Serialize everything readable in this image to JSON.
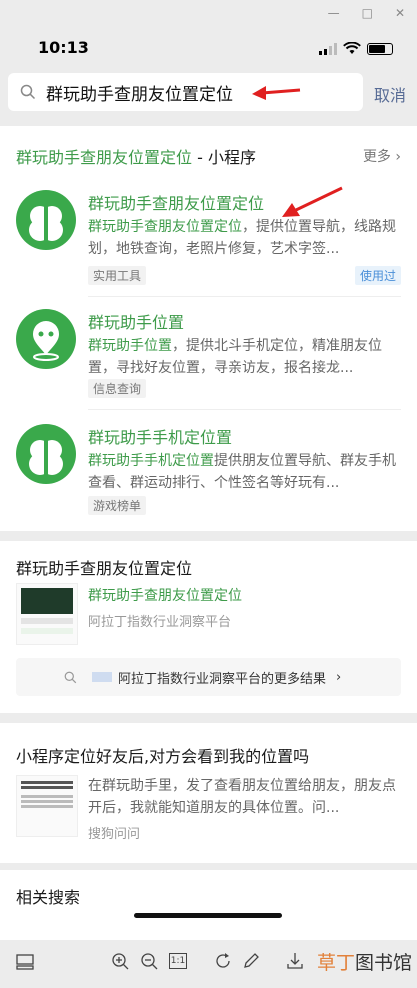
{
  "status": {
    "time": "10:13"
  },
  "search": {
    "query": "群玩助手查朋友位置定位",
    "cancel": "取消"
  },
  "miniprogram_section": {
    "title_main": "群玩助手查朋友位置定位",
    "title_suffix": " - 小程序",
    "more": "更多"
  },
  "mini_programs": [
    {
      "title": "群玩助手查朋友位置定位",
      "desc_hl": "群玩助手查朋友位置定位",
      "desc_rest": "，提供位置导航，线路规划，地铁查询，老照片修复，艺术字签...",
      "tag": "实用工具",
      "badge": "使用过"
    },
    {
      "title": "群玩助手位置",
      "desc_hl": "群玩助手位置",
      "desc_rest": "，提供北斗手机定位，精准朋友位置，寻找好友位置，寻亲访友，报名接龙...",
      "tag": "信息查询"
    },
    {
      "title": "群玩助手手机定位置",
      "desc_hl": "群玩助手手机定位置",
      "desc_rest": "提供朋友位置导航、群友手机查看、群运动排行、个性签名等好玩有...",
      "tag": "游戏榜单"
    }
  ],
  "article_section": {
    "title": "群玩助手查朋友位置定位",
    "item_title": "群玩助手查朋友位置定位",
    "item_source": "阿拉丁指数行业洞察平台",
    "more_results": "阿拉丁指数行业洞察平台的更多结果"
  },
  "qa_section": {
    "title": "小程序定位好友后,对方会看到我的位置吗",
    "desc": "在群玩助手里，发了查看朋友位置给朋友，朋友点开后，我就能知道朋友的具体位置。问...",
    "source": "搜狗问问"
  },
  "related": {
    "title": "相关搜索"
  },
  "bottom": {
    "brand_a": "草丁",
    "brand_b": "图书馆",
    "zoom_label": "1:1"
  },
  "colors": {
    "accent_green": "#3e9b4a",
    "link_blue": "#576b95",
    "arrow_red": "#e02020"
  }
}
